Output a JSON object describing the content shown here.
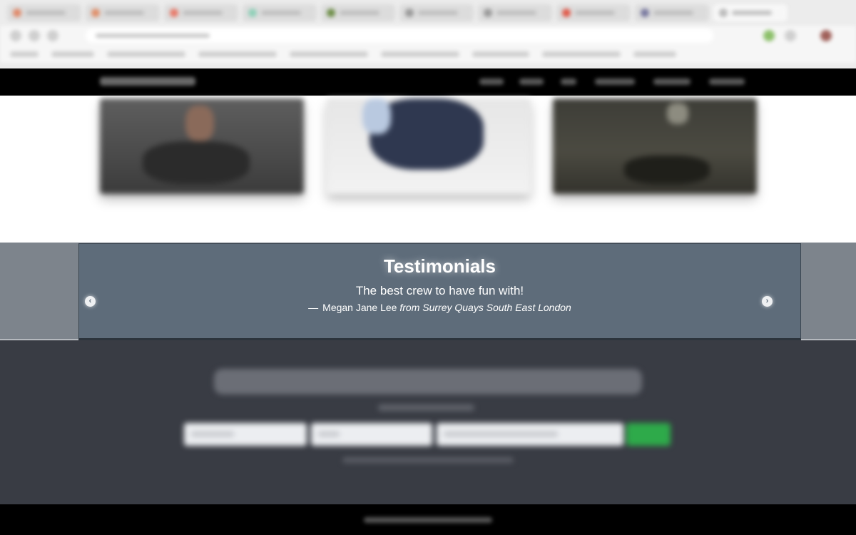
{
  "testimonials": {
    "title": "Testimonials",
    "quote": "The best crew to have fun with!",
    "dash": "—",
    "author": "Megan Jane Lee",
    "location": "from Surrey Quays South East London",
    "prev_icon": "chevron-left-icon",
    "next_icon": "chevron-right-icon"
  },
  "colors": {
    "nav_bg": "#000000",
    "testimonial_bg": "#5e6c7a",
    "share_bg": "#393c44",
    "submit_button": "#2eaa4a",
    "footer_bg": "#000000"
  }
}
